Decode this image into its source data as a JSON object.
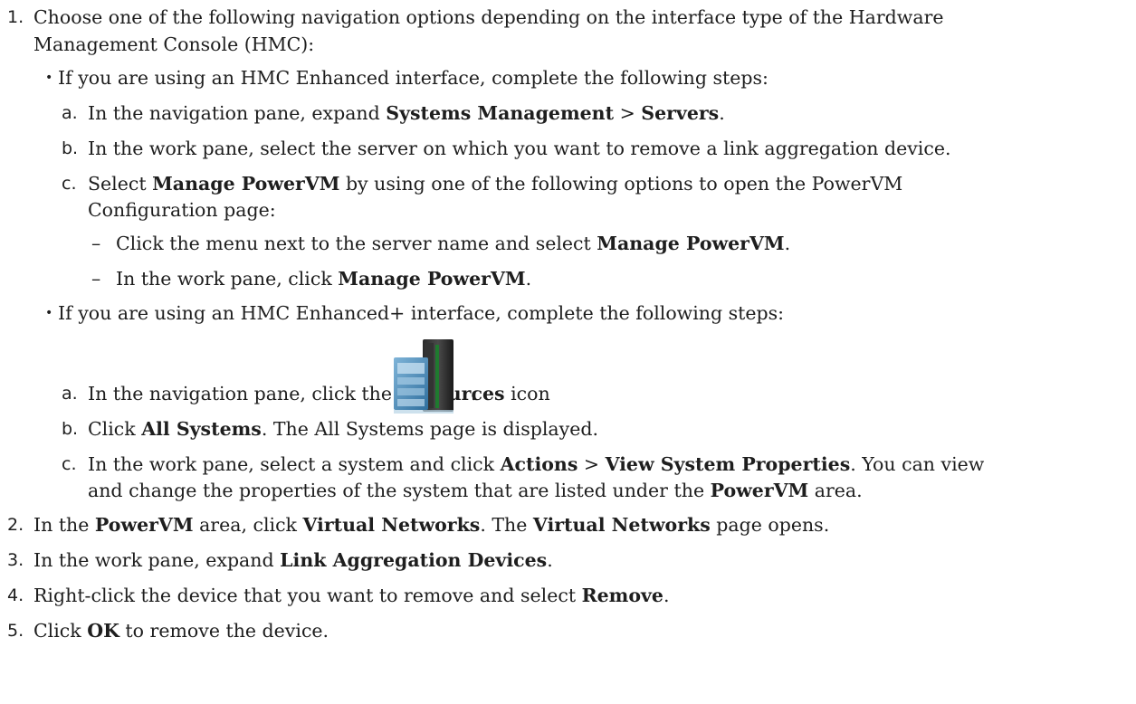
{
  "steps": {
    "s1": {
      "num": "1.",
      "line1": "Choose one of the following navigation options depending on the interface type of the Hardware",
      "line2": "Management Console (HMC):",
      "enhanced": {
        "bullet_text": "If you are using an HMC Enhanced interface, complete the following steps:",
        "a": {
          "letter": "a.",
          "pre": "In the navigation pane, expand ",
          "b1": "Systems Management",
          "mid": " > ",
          "b2": "Servers",
          "post": "."
        },
        "b": {
          "letter": "b.",
          "text": "In the work pane, select the server on which you want to remove a link aggregation device."
        },
        "c": {
          "letter": "c.",
          "pre": "Select ",
          "b1": "Manage PowerVM",
          "post": " by using one of the following options to open the PowerVM",
          "line2": "Configuration page:",
          "dash1": {
            "dash": "–",
            "pre": "Click the menu next to the server name and select ",
            "b1": "Manage PowerVM",
            "post": "."
          },
          "dash2": {
            "dash": "–",
            "pre": "In the work pane, click ",
            "b1": "Manage PowerVM",
            "post": "."
          }
        }
      },
      "enhanced_plus": {
        "bullet_text": "If you are using an HMC Enhanced+ interface, complete the following steps:",
        "a": {
          "letter": "a.",
          "pre": "In the navigation pane, click the ",
          "b1": "Resources",
          "post": " icon",
          "after_icon": "."
        },
        "b": {
          "letter": "b.",
          "pre": "Click ",
          "b1": "All Systems",
          "post": ". The All Systems page is displayed."
        },
        "c": {
          "letter": "c.",
          "pre": "In the work pane, select a system and click ",
          "b1": "Actions",
          "mid": " > ",
          "b2": "View System Properties",
          "post": ". You can view",
          "l2pre": "and change the properties of the system that are listed under the ",
          "l2b": "PowerVM",
          "l2post": " area."
        }
      },
      "bullet": "•"
    },
    "s2": {
      "num": "2.",
      "pre": "In the ",
      "b1": "PowerVM",
      "mid1": " area, click ",
      "b2": "Virtual Networks",
      "mid2": ". The ",
      "b3": "Virtual Networks",
      "post": " page opens."
    },
    "s3": {
      "num": "3.",
      "pre": "In the work pane, expand ",
      "b1": "Link Aggregation Devices",
      "post": "."
    },
    "s4": {
      "num": "4.",
      "pre": "Right-click the device that you want to remove and select ",
      "b1": "Remove",
      "post": "."
    },
    "s5": {
      "num": "5.",
      "pre": "Click ",
      "b1": "OK",
      "post": " to remove the device."
    }
  },
  "icons": {
    "resources": "server-rack-icon"
  }
}
